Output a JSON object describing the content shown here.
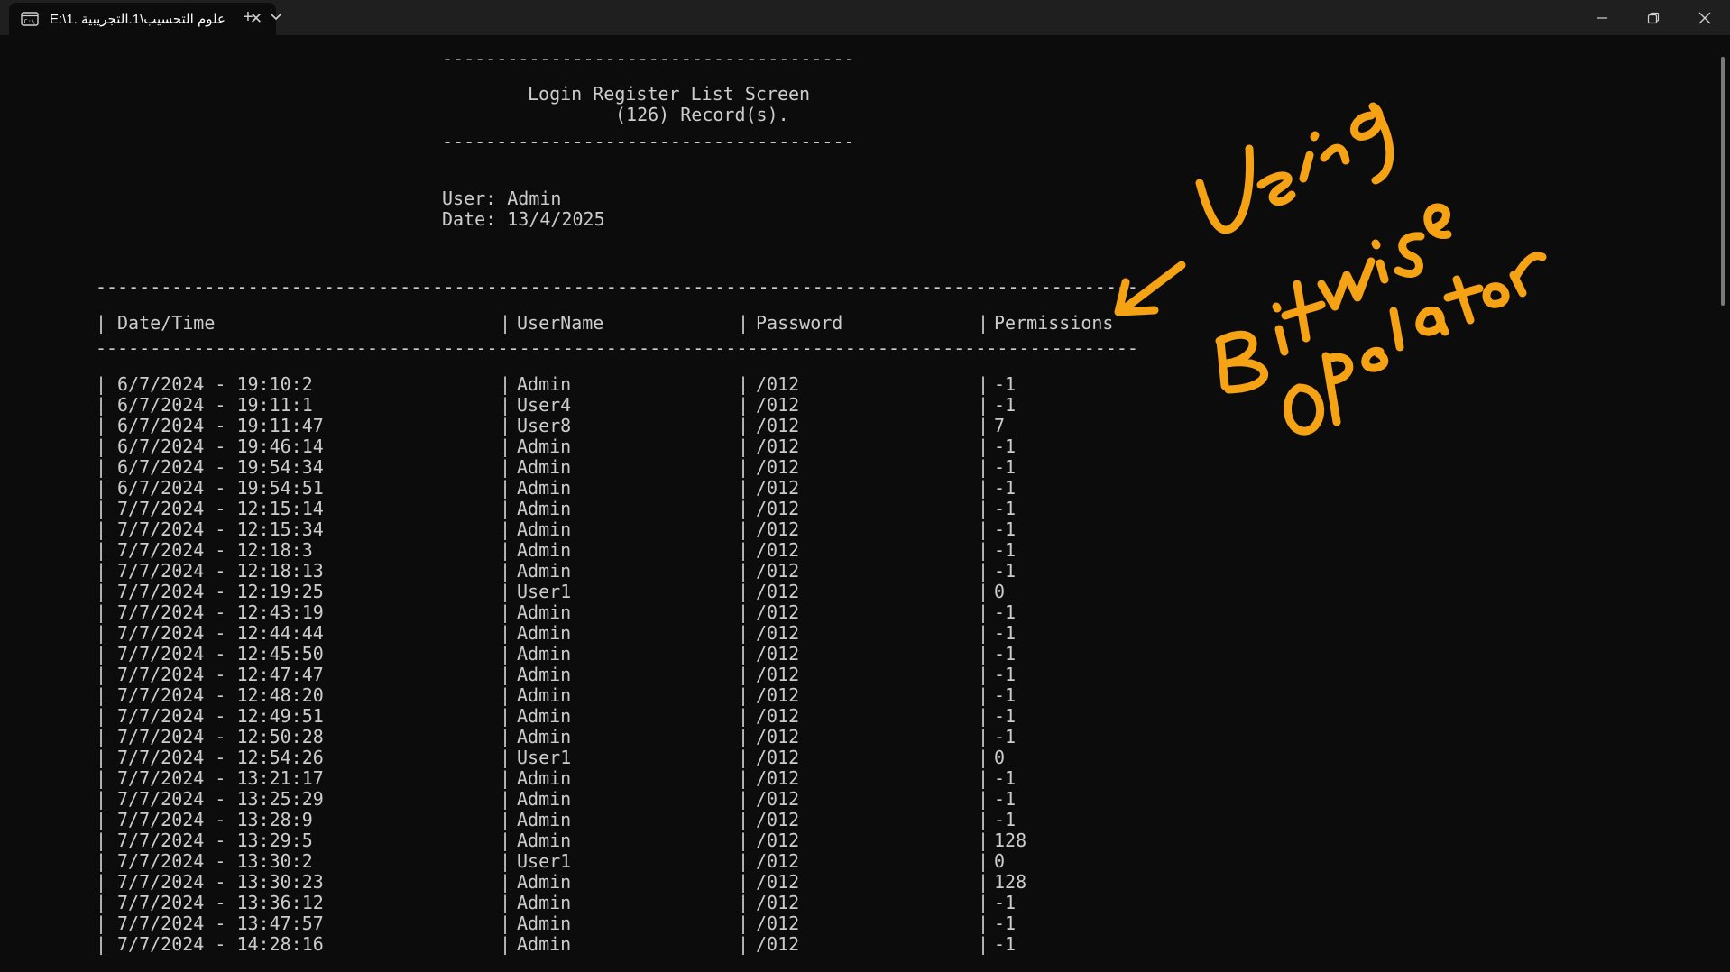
{
  "window": {
    "tab_title": "E:\\1. علوم التحسيب\\1.التجريبية",
    "tab_icon": "terminal-icon",
    "tab_close_glyph": "✕",
    "new_tab_glyph": "+",
    "dropdown_glyph": "⌄"
  },
  "console": {
    "rule_short": "--------------------------------------",
    "screen_title": "Login Register List Screen",
    "record_count": "(126) Record(s).",
    "user_line": "User: Admin",
    "date_line": "Date: 13/4/2025",
    "rule_long": "------------------------------------------------------------------------------------------------",
    "columns": [
      "Date/Time",
      "UserName",
      "Password",
      "Permissions"
    ],
    "rows": [
      [
        "6/7/2024 - 19:10:2",
        "Admin",
        "/012",
        "-1"
      ],
      [
        "6/7/2024 - 19:11:1",
        "User4",
        "/012",
        "-1"
      ],
      [
        "6/7/2024 - 19:11:47",
        "User8",
        "/012",
        "7"
      ],
      [
        "6/7/2024 - 19:46:14",
        "Admin",
        "/012",
        "-1"
      ],
      [
        "6/7/2024 - 19:54:34",
        "Admin",
        "/012",
        "-1"
      ],
      [
        "6/7/2024 - 19:54:51",
        "Admin",
        "/012",
        "-1"
      ],
      [
        "7/7/2024 - 12:15:14",
        "Admin",
        "/012",
        "-1"
      ],
      [
        "7/7/2024 - 12:15:34",
        "Admin",
        "/012",
        "-1"
      ],
      [
        "7/7/2024 - 12:18:3",
        "Admin",
        "/012",
        "-1"
      ],
      [
        "7/7/2024 - 12:18:13",
        "Admin",
        "/012",
        "-1"
      ],
      [
        "7/7/2024 - 12:19:25",
        "User1",
        "/012",
        "0"
      ],
      [
        "7/7/2024 - 12:43:19",
        "Admin",
        "/012",
        "-1"
      ],
      [
        "7/7/2024 - 12:44:44",
        "Admin",
        "/012",
        "-1"
      ],
      [
        "7/7/2024 - 12:45:50",
        "Admin",
        "/012",
        "-1"
      ],
      [
        "7/7/2024 - 12:47:47",
        "Admin",
        "/012",
        "-1"
      ],
      [
        "7/7/2024 - 12:48:20",
        "Admin",
        "/012",
        "-1"
      ],
      [
        "7/7/2024 - 12:49:51",
        "Admin",
        "/012",
        "-1"
      ],
      [
        "7/7/2024 - 12:50:28",
        "Admin",
        "/012",
        "-1"
      ],
      [
        "7/7/2024 - 12:54:26",
        "User1",
        "/012",
        "0"
      ],
      [
        "7/7/2024 - 13:21:17",
        "Admin",
        "/012",
        "-1"
      ],
      [
        "7/7/2024 - 13:25:29",
        "Admin",
        "/012",
        "-1"
      ],
      [
        "7/7/2024 - 13:28:9",
        "Admin",
        "/012",
        "-1"
      ],
      [
        "7/7/2024 - 13:29:5",
        "Admin",
        "/012",
        "128"
      ],
      [
        "7/7/2024 - 13:30:2",
        "User1",
        "/012",
        "0"
      ],
      [
        "7/7/2024 - 13:30:23",
        "Admin",
        "/012",
        "128"
      ],
      [
        "7/7/2024 - 13:36:12",
        "Admin",
        "/012",
        "-1"
      ],
      [
        "7/7/2024 - 13:47:57",
        "Admin",
        "/012",
        "-1"
      ],
      [
        "7/7/2024 - 14:28:16",
        "Admin",
        "/012",
        "-1"
      ]
    ]
  },
  "annotation": {
    "text": "Using Bitwise Operator",
    "color": "#f5a314"
  },
  "colors": {
    "background": "#0c0c0c",
    "titlebar": "#1f1f1f",
    "text": "#cccccc"
  }
}
